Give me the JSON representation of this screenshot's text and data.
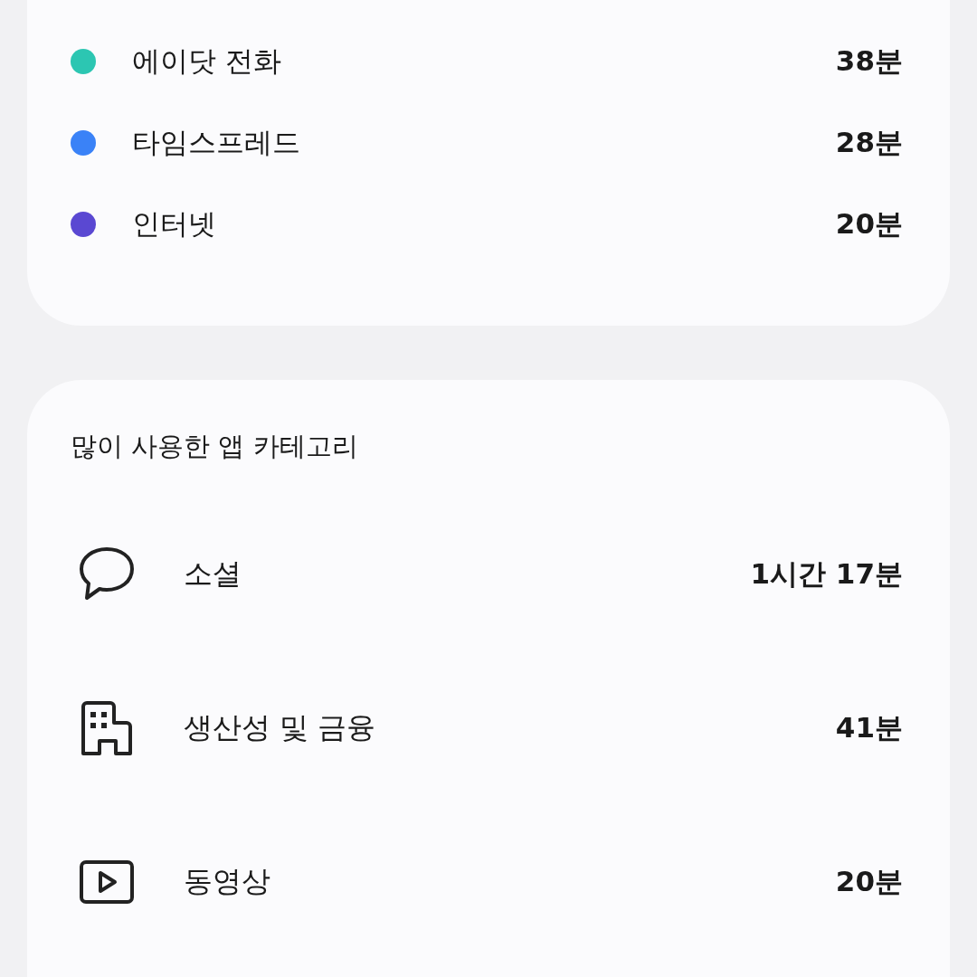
{
  "apps": [
    {
      "name": "에이닷 전화",
      "time": "38분",
      "color": "#2cc6b2"
    },
    {
      "name": "타임스프레드",
      "time": "28분",
      "color": "#3a82f7"
    },
    {
      "name": "인터넷",
      "time": "20분",
      "color": "#5a48d2"
    }
  ],
  "categories": {
    "title": "많이 사용한 앱 카테고리",
    "items": [
      {
        "kind": "chat",
        "name": "소셜",
        "time": "1시간 17분"
      },
      {
        "kind": "building",
        "name": "생산성 및 금융",
        "time": "41분"
      },
      {
        "kind": "video",
        "name": "동영상",
        "time": "20분"
      }
    ]
  }
}
